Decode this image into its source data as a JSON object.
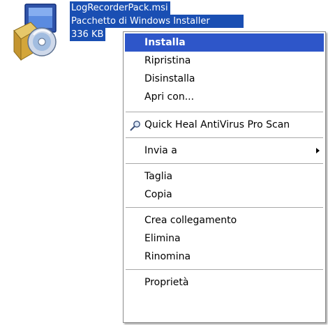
{
  "file": {
    "name": "LogRecorderPack.msi",
    "type": "Pacchetto di Windows Installer",
    "size": "336 KB",
    "icon": "msi-installer-icon"
  },
  "menu": {
    "install": "Installa",
    "repair": "Ripristina",
    "uninstall": "Disinstalla",
    "open_with": "Apri con...",
    "antivirus_scan": "Quick Heal AntiVirus Pro Scan",
    "send_to": "Invia a",
    "cut": "Taglia",
    "copy": "Copia",
    "create_shortcut": "Crea collegamento",
    "delete": "Elimina",
    "rename": "Rinomina",
    "properties": "Proprietà"
  },
  "colors": {
    "selection": "#2e56c9",
    "file_highlight": "#1a4fb3"
  }
}
